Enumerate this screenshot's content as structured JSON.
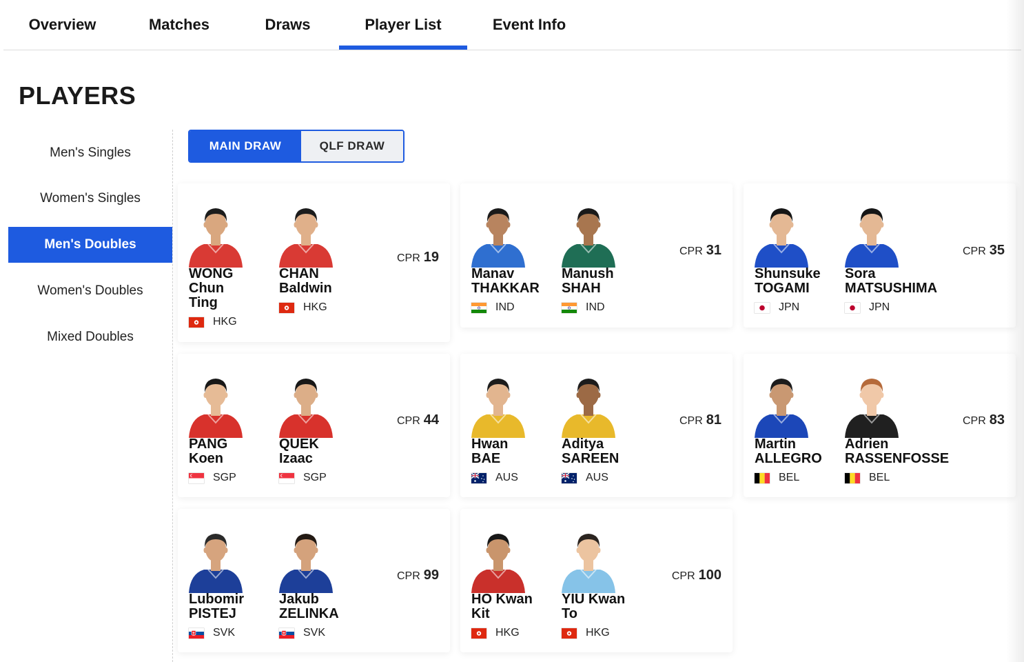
{
  "nav": {
    "tabs": [
      {
        "label": "Overview"
      },
      {
        "label": "Matches"
      },
      {
        "label": "Draws"
      },
      {
        "label": "Player List",
        "active": true
      },
      {
        "label": "Event Info"
      }
    ]
  },
  "page_title": "PLAYERS",
  "sidebar": {
    "items": [
      {
        "label": "Men's Singles"
      },
      {
        "label": "Women's Singles"
      },
      {
        "label": "Men's Doubles",
        "active": true
      },
      {
        "label": "Women's Doubles"
      },
      {
        "label": "Mixed Doubles"
      }
    ]
  },
  "draw_toggle": {
    "main": "MAIN DRAW",
    "qlf": "QLF DRAW",
    "selected": "main"
  },
  "cpr_label": "CPR",
  "pairs": [
    {
      "cpr": "19",
      "players": [
        {
          "name_lines": [
            "WONG",
            "Chun",
            "Ting"
          ],
          "country": "HKG",
          "shirt": "#d93a34",
          "skin": "#d9a77f",
          "hair": "#1c1c1c"
        },
        {
          "name_lines": [
            "CHAN",
            "Baldwin"
          ],
          "country": "HKG",
          "shirt": "#d93a34",
          "skin": "#e0b08a",
          "hair": "#1c1c1c"
        }
      ]
    },
    {
      "cpr": "31",
      "players": [
        {
          "name_lines": [
            "Manav",
            "THAKKAR"
          ],
          "country": "IND",
          "shirt": "#2f6fd0",
          "skin": "#b8845f",
          "hair": "#1a1a1a"
        },
        {
          "name_lines": [
            "Manush",
            "SHAH"
          ],
          "country": "IND",
          "shirt": "#1f6e55",
          "skin": "#a8764f",
          "hair": "#1a1a1a"
        }
      ]
    },
    {
      "cpr": "35",
      "players": [
        {
          "name_lines": [
            "Shunsuke",
            "TOGAMI"
          ],
          "country": "JPN",
          "shirt": "#1f4fc7",
          "skin": "#e4b894",
          "hair": "#161616"
        },
        {
          "name_lines": [
            "Sora",
            "MATSUSHIMA"
          ],
          "country": "JPN",
          "shirt": "#1f4fc7",
          "skin": "#e4b894",
          "hair": "#161616"
        }
      ]
    },
    {
      "cpr": "44",
      "players": [
        {
          "name_lines": [
            "PANG",
            "Koen"
          ],
          "country": "SGP",
          "shirt": "#d8322c",
          "skin": "#e6bb96",
          "hair": "#181818"
        },
        {
          "name_lines": [
            "QUEK",
            "Izaac"
          ],
          "country": "SGP",
          "shirt": "#d8322c",
          "skin": "#dcae88",
          "hair": "#181818"
        }
      ]
    },
    {
      "cpr": "81",
      "players": [
        {
          "name_lines": [
            "Hwan",
            "BAE"
          ],
          "country": "AUS",
          "shirt": "#e8b92b",
          "skin": "#e2b58f",
          "hair": "#1c1c1c"
        },
        {
          "name_lines": [
            "Aditya",
            "SAREEN"
          ],
          "country": "AUS",
          "shirt": "#e8b92b",
          "skin": "#9c6a45",
          "hair": "#1c1c1c"
        }
      ]
    },
    {
      "cpr": "83",
      "players": [
        {
          "name_lines": [
            "Martin",
            "ALLEGRO"
          ],
          "country": "BEL",
          "shirt": "#1c47b8",
          "skin": "#c99872",
          "hair": "#1c1c1c"
        },
        {
          "name_lines": [
            "Adrien",
            "RASSENFOSSE"
          ],
          "country": "BEL",
          "shirt": "#202020",
          "skin": "#f0c8a8",
          "hair": "#b56a3a"
        }
      ]
    },
    {
      "cpr": "99",
      "players": [
        {
          "name_lines": [
            "Lubomir",
            "PISTEJ"
          ],
          "country": "SVK",
          "shirt": "#1d3f99",
          "skin": "#d6a47e",
          "hair": "#2a2a2a"
        },
        {
          "name_lines": [
            "Jakub",
            "ZELINKA"
          ],
          "country": "SVK",
          "shirt": "#1d3f99",
          "skin": "#d4a27c",
          "hair": "#231a14"
        }
      ]
    },
    {
      "cpr": "100",
      "players": [
        {
          "name_lines": [
            "HO Kwan",
            "Kit"
          ],
          "country": "HKG",
          "shirt": "#c9302b",
          "skin": "#c9956c",
          "hair": "#181818"
        },
        {
          "name_lines": [
            "YIU Kwan",
            "To"
          ],
          "country": "HKG",
          "shirt": "#86c3e8",
          "skin": "#ecc4a0",
          "hair": "#2b2420"
        }
      ]
    }
  ]
}
